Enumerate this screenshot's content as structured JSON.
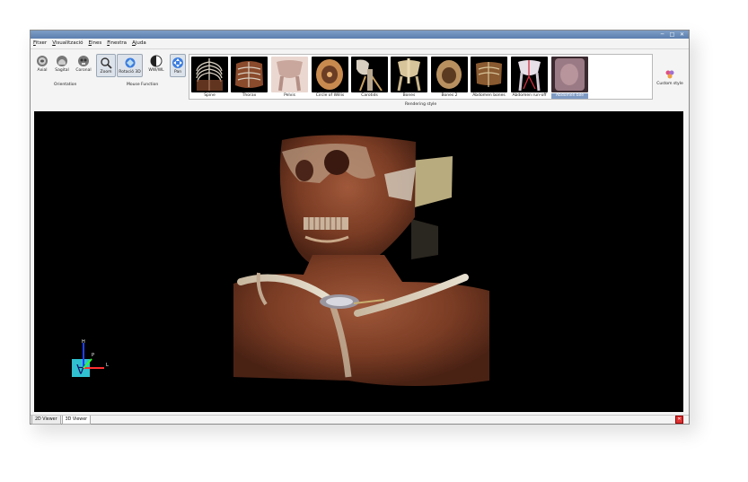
{
  "menu": {
    "items": [
      "Fitxer",
      "Visualització",
      "Eines",
      "Finestra",
      "Ajuda"
    ]
  },
  "toolbar": {
    "orientation": {
      "label": "Orientation",
      "buttons": [
        {
          "label": "Axial",
          "icon": "axial-skull-icon"
        },
        {
          "label": "Sagital",
          "icon": "sagittal-skull-icon"
        },
        {
          "label": "Coronal",
          "icon": "coronal-skull-icon"
        }
      ]
    },
    "mouse_function": {
      "label": "Mouse Function",
      "buttons": [
        {
          "label": "Zoom",
          "icon": "magnifier-icon"
        },
        {
          "label": "Rotació 3D",
          "icon": "rotate-3d-icon"
        },
        {
          "label": "WW/WL",
          "icon": "window-level-icon"
        },
        {
          "label": "Pan",
          "icon": "pan-arrows-icon"
        }
      ]
    },
    "rendering_style": {
      "label": "Rendering style",
      "thumbnails": [
        "Spine",
        "Thorax",
        "Pelvis",
        "Circle of Willis",
        "Carotids",
        "Bones",
        "Bones 2",
        "Abdomen bones",
        "Abdomen run-off",
        "Abdomen bile"
      ],
      "selected": "Abdomen bile"
    },
    "custom_style": {
      "label": "Custom style",
      "icon": "palette-icon"
    }
  },
  "viewport": {
    "background": "#000000",
    "axes": {
      "s_label": "H",
      "p_label": "P",
      "l_label": "L",
      "cube_face": "A"
    }
  },
  "tabs": [
    "2D Viewer",
    "3D Viewer"
  ],
  "active_tab": "3D Viewer",
  "colors": {
    "titlebar": "#5b7fae",
    "selection": "#7f9bc4",
    "tissue": "#8a4a2c",
    "bone": "#d8cfc0"
  }
}
